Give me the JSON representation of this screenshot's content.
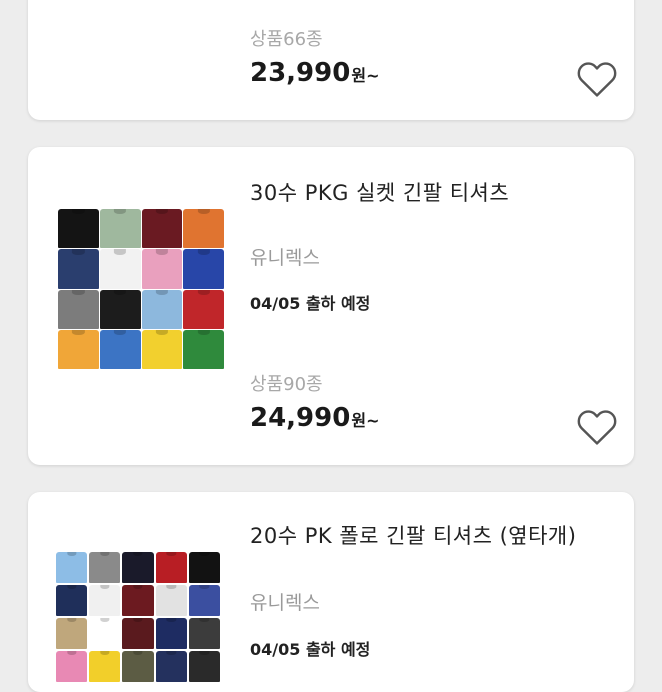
{
  "products": [
    {
      "count": "상품66종",
      "price": "23,990",
      "price_suffix": "원~",
      "swatch_colors": [
        "#e8742a",
        "#7fc640",
        "#3d9be0",
        "#3aa04a"
      ]
    },
    {
      "title": "30수 PKG 실켓 긴팔 티셔츠",
      "brand": "유니렉스",
      "ship_date": "04/05 출하 예정",
      "count": "상품90종",
      "price": "24,990",
      "price_suffix": "원~",
      "swatch_colors": [
        "#141414",
        "#9fb89e",
        "#6a1a22",
        "#e07430",
        "#2a3e6e",
        "#f2f2f2",
        "#e9a0be",
        "#2846a8",
        "#7c7c7c",
        "#1c1c1c",
        "#8db8dd",
        "#c0262a",
        "#f0a638",
        "#3c74c4",
        "#f2d02e",
        "#2f8a3c"
      ]
    },
    {
      "title": "20수 PK 폴로 긴팔 티셔츠 (옆타개)",
      "brand": "유니렉스",
      "ship_date": "04/05 출하 예정",
      "swatch_colors": [
        "#8dbde6",
        "#8a8a8a",
        "#1a1a2a",
        "#b81e24",
        "#121212",
        "#1f2f5a",
        "#f0f0f0",
        "#6c1a20",
        "#e2e2e2",
        "#3b4fa0",
        "#bfa77c",
        "#ffffff",
        "#5a1a1e",
        "#1e2c62",
        "#3c3c3c",
        "#e889b4",
        "#f2cf2a",
        "#5c5c44",
        "#24315e",
        "#2a2a2a"
      ]
    }
  ]
}
